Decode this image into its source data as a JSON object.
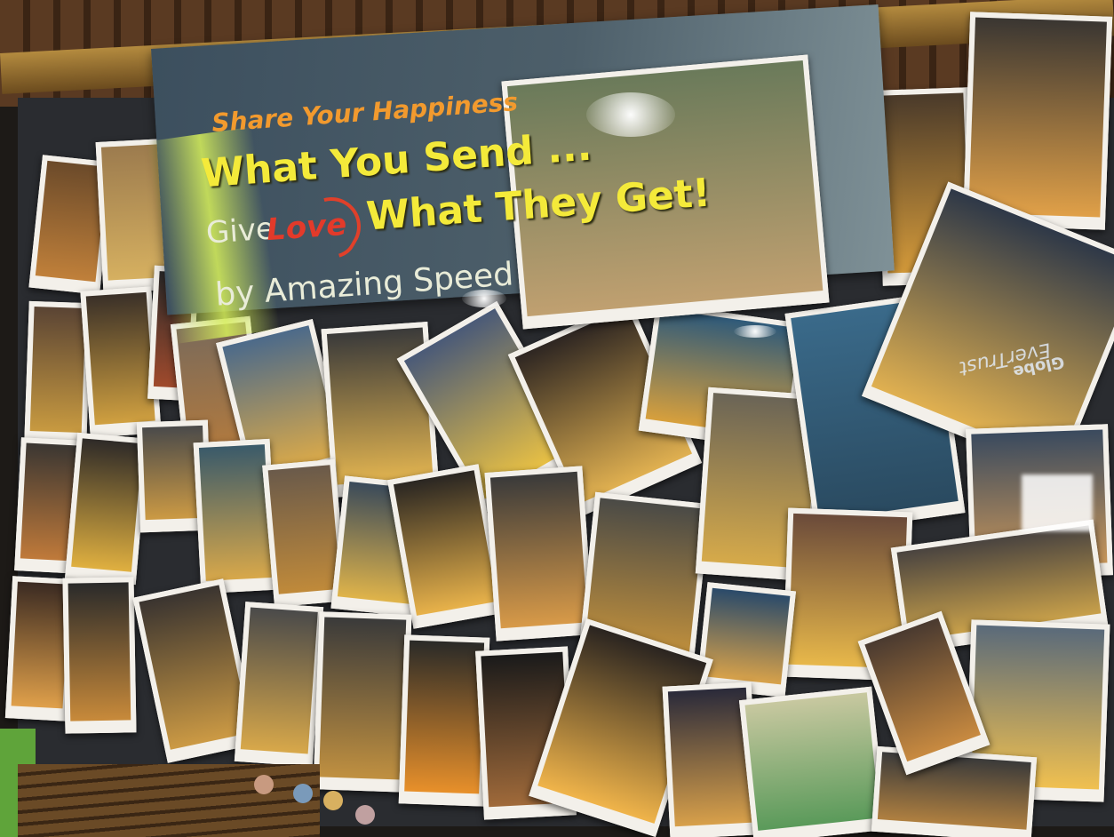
{
  "banner": {
    "line1": "Share Your Happiness",
    "line2": "What You Send ...",
    "line3_give": "Give",
    "line3_love": "Love",
    "line3_get": "What They Get!",
    "line4": "by Amazing Speed"
  },
  "sticker": {
    "globe": "Globe",
    "text": "EverTrust"
  },
  "colors": {
    "headline_yellow": "#f4ea3a",
    "tagline_orange": "#f29a2e",
    "love_red": "#e33a2a",
    "banner_blue": "#3c4f5e"
  }
}
